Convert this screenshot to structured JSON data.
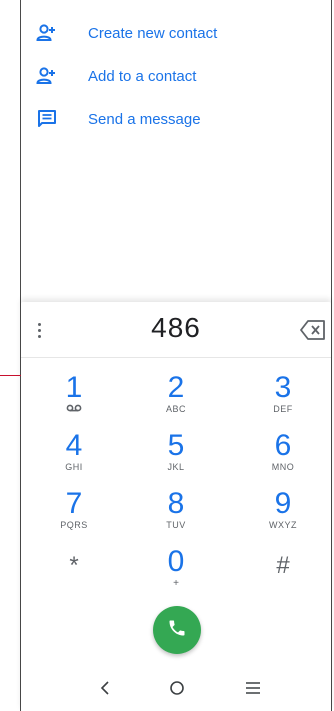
{
  "actions": [
    {
      "label": "Create new contact",
      "icon": "add-person-icon"
    },
    {
      "label": "Add to a contact",
      "icon": "add-person-icon"
    },
    {
      "label": "Send a message",
      "icon": "message-icon"
    }
  ],
  "dialpad": {
    "digits": "486",
    "keys": [
      {
        "num": "1",
        "sub": "",
        "extra": "voicemail-icon"
      },
      {
        "num": "2",
        "sub": "ABC"
      },
      {
        "num": "3",
        "sub": "DEF"
      },
      {
        "num": "4",
        "sub": "GHI"
      },
      {
        "num": "5",
        "sub": "JKL"
      },
      {
        "num": "6",
        "sub": "MNO"
      },
      {
        "num": "7",
        "sub": "PQRS"
      },
      {
        "num": "8",
        "sub": "TUV"
      },
      {
        "num": "9",
        "sub": "WXYZ"
      },
      {
        "num": "*",
        "sub": ""
      },
      {
        "num": "0",
        "sub": "+"
      },
      {
        "num": "#",
        "sub": ""
      }
    ]
  },
  "colors": {
    "accent": "#1a73e8",
    "call": "#34a853",
    "callout": "#c8102e"
  },
  "icons": {
    "call": "phone-icon",
    "overflow": "more-vert-icon",
    "backspace": "backspace-icon",
    "nav_back": "back-icon",
    "nav_home": "home-icon",
    "nav_recents": "recents-icon"
  }
}
